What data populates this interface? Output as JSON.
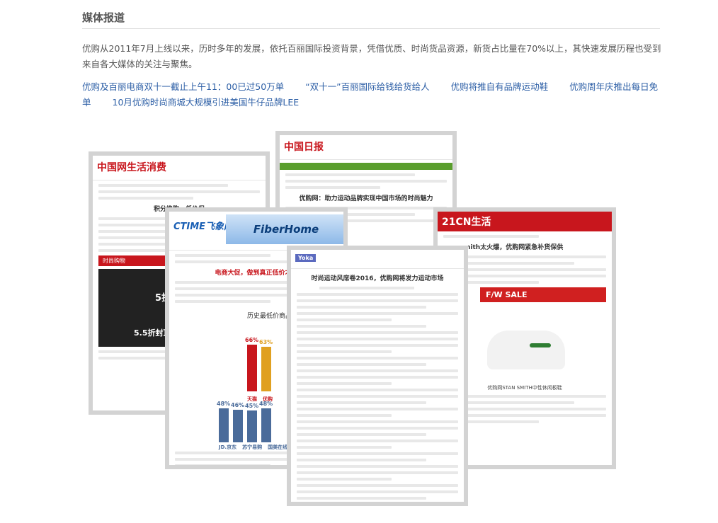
{
  "section": {
    "title": "媒体报道",
    "intro": "优购从2011年7月上线以来，历时多年的发展，依托百丽国际投资背景，凭借优质、时尚货品资源，新货占比量在70%以上，其快速发展历程也受到来自各大媒体的关注与聚焦。"
  },
  "links": [
    "优购及百丽电商双十一截止上午11：00已过50万单",
    "“双十一”百丽国际给钱给货给人",
    "优购将推自有品牌运动鞋",
    "优购周年庆推出每日免单",
    "10月优购时尚商城大规模引进美国牛仔品牌LEE"
  ],
  "clippings": {
    "card1": {
      "logo": "中国网生活消费",
      "headline": "积分换购、低价促",
      "banner": "时尚购物",
      "promo_text": "5折起",
      "promo_text2": "5.5折封顶"
    },
    "card2": {
      "logo": "中国日报",
      "headline": "优购网：助力运动品牌实现中国市场的时尚魅力"
    },
    "card3": {
      "logo": "CTIME飞象网",
      "banner_brand": "FiberHome",
      "headline": "电商大促，做到真正低价才是",
      "chart_title": "历史最低价商品",
      "bar_values": [
        "66%",
        "63%",
        "48%",
        "46%",
        "45%",
        "48%"
      ],
      "brands": [
        "天猫",
        "优购",
        "JD.京东",
        "苏宁易购",
        "国美在线"
      ]
    },
    "card4": {
      "logo": "21CN生活",
      "headline": "nith太火爆，优购网紧急补货保供",
      "sale_banner": "F/W SALE",
      "caption": "优购网STAN SMITH中性休闲板鞋"
    },
    "card5": {
      "logo": "Yoka",
      "headline": "时尚运动风席卷2016，优购网将发力运动市场"
    }
  },
  "colors": {
    "link": "#2d5fa6",
    "text": "#555555",
    "accent_red": "#c8161d"
  }
}
